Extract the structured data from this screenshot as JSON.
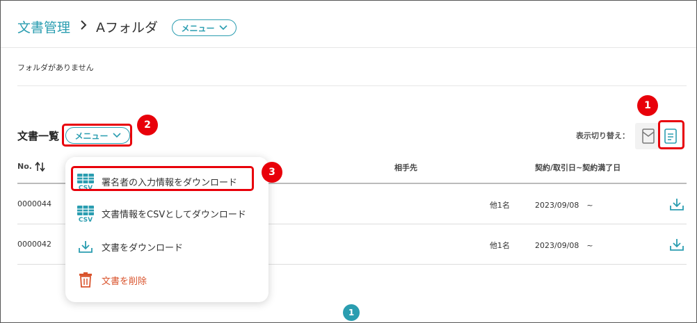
{
  "header": {
    "breadcrumb_root": "文書管理",
    "current_folder": "Aフォルダ",
    "menu_label": "メニュー"
  },
  "folders": {
    "empty_message": "フォルダがありません"
  },
  "document_list": {
    "title": "文書一覧",
    "menu_label": "メニュー",
    "view_toggle_label": "表示切り替え：",
    "columns": {
      "no": "No.",
      "counterparty": "相手先",
      "date": "契約/取引日~契約満了日"
    },
    "rows": [
      {
        "no": "0000044",
        "counterparty": "他1名",
        "date": "2023/09/08　~"
      },
      {
        "no": "0000042",
        "counterparty": "他1名",
        "date": "2023/09/08　~"
      }
    ]
  },
  "dropdown_menu": {
    "items": [
      {
        "label": "署名者の入力情報をダウンロード",
        "icon": "csv-icon"
      },
      {
        "label": "文書情報をCSVとしてダウンロード",
        "icon": "csv-icon"
      },
      {
        "label": "文書をダウンロード",
        "icon": "download-icon"
      },
      {
        "label": "文書を削除",
        "icon": "trash-icon"
      }
    ]
  },
  "pagination": {
    "current_page": "1"
  },
  "annotations": {
    "badge_1": "1",
    "badge_2": "2",
    "badge_3": "3"
  },
  "colors": {
    "accent": "#2a9db0",
    "danger": "#d9532c",
    "annotation_red": "#e8000a"
  }
}
